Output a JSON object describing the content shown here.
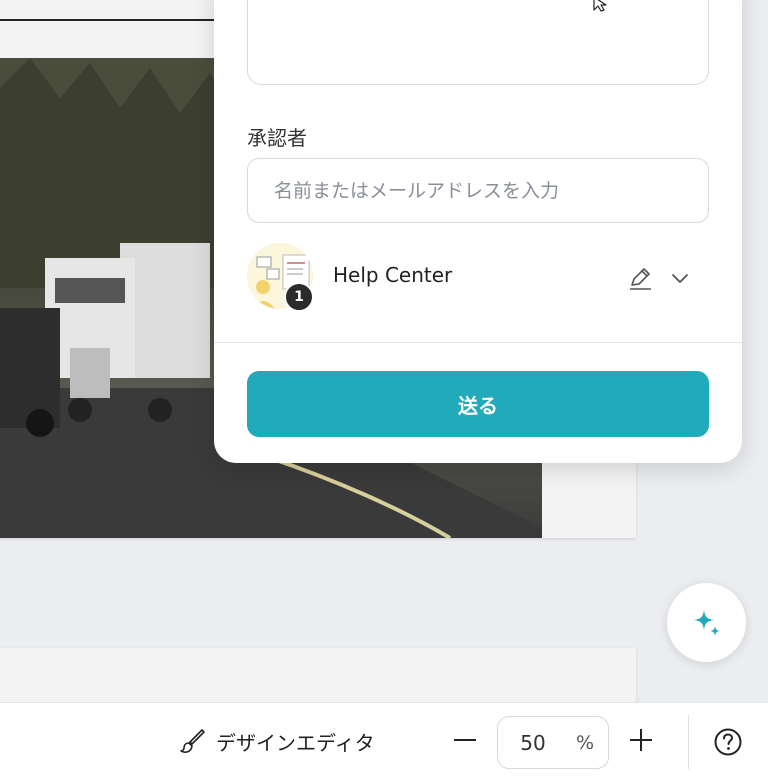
{
  "approval_panel": {
    "approver_label": "承認者",
    "approver_placeholder": "名前またはメールアドレスを入力",
    "reviewer": {
      "name": "Help Center",
      "badge_count": "1"
    },
    "send_label": "送る"
  },
  "toolbar": {
    "design_editor_label": "デザインエディタ",
    "zoom_value": "50",
    "zoom_unit": "%"
  },
  "icons": {
    "edit": "pencil-icon",
    "expand": "chevron-down-icon",
    "ai_assistant": "sparkle-icon",
    "brush": "brush-icon",
    "zoom_out": "minus-icon",
    "zoom_in": "plus-icon",
    "help": "question-circle-icon"
  },
  "colors": {
    "primary": "#21aab9",
    "panel_background": "#ffffff",
    "workspace_background": "#ebedf0"
  }
}
